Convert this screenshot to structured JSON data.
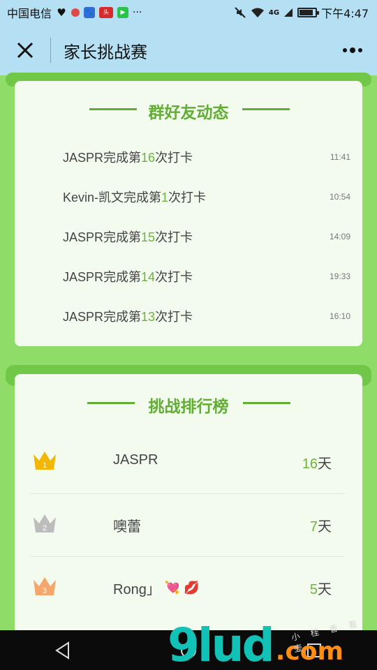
{
  "status_bar": {
    "carrier": "中国电信",
    "time": "下午4:47",
    "network": "4G"
  },
  "header": {
    "title": "家长挑战赛"
  },
  "feed": {
    "title": "群好友动态",
    "items": [
      {
        "prefix": "JASPR完成第",
        "num": "16",
        "suffix": "次打卡",
        "time": "11:41"
      },
      {
        "prefix": "Kevin-凯文完成第",
        "num": "1",
        "suffix": "次打卡",
        "time": "10:54"
      },
      {
        "prefix": "JASPR完成第",
        "num": "15",
        "suffix": "次打卡",
        "time": "14:09"
      },
      {
        "prefix": "JASPR完成第",
        "num": "14",
        "suffix": "次打卡",
        "time": "19:33"
      },
      {
        "prefix": "JASPR完成第",
        "num": "13",
        "suffix": "次打卡",
        "time": "16:10"
      }
    ]
  },
  "ranking": {
    "title": "挑战排行榜",
    "rows": [
      {
        "rank": "1",
        "name": "JASPR",
        "days": "16",
        "unit": "天",
        "crown_color": "#f2b705"
      },
      {
        "rank": "2",
        "name": "噢蕾",
        "days": "7",
        "unit": "天",
        "crown_color": "#bdbdbd"
      },
      {
        "rank": "3",
        "name": "Rong」",
        "days": "5",
        "unit": "天",
        "crown_color": "#f5a66a",
        "emoji": "💘 💋"
      }
    ]
  },
  "watermark": {
    "brand": "9lud",
    "domain": ".com",
    "tagline": "小 桂 香 看 壶"
  }
}
